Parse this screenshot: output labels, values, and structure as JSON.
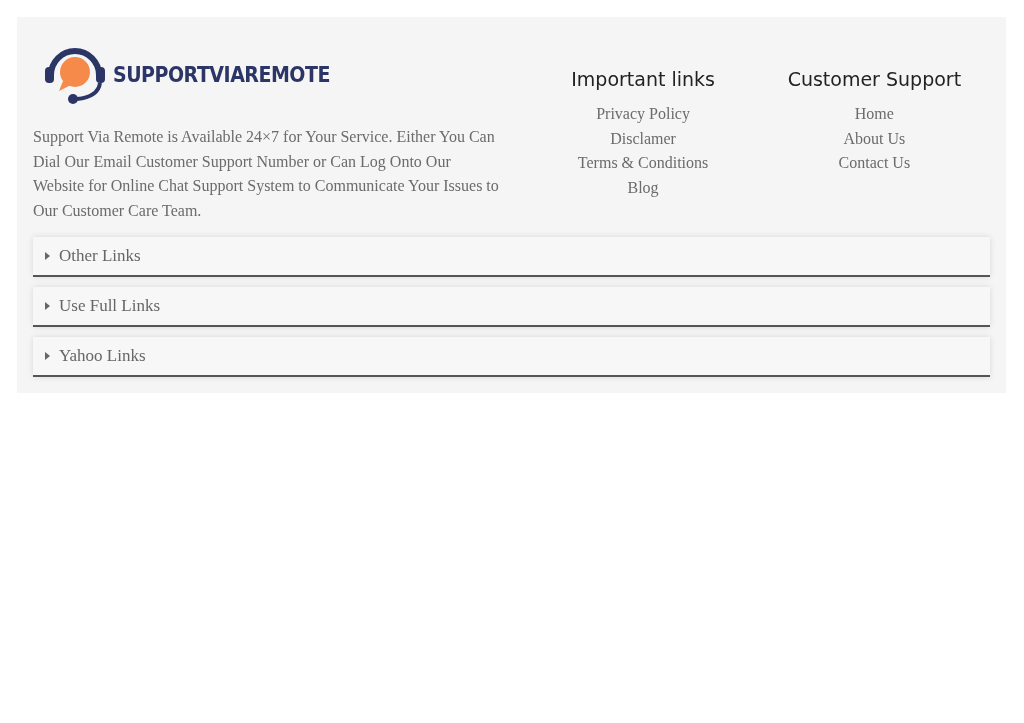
{
  "logo": {
    "text": "SUPPORTVIAREMOTE"
  },
  "about": "Support Via Remote is Available 24×7 for Your Service. Either You Can Dial Our Email Customer Support Number or Can Log Onto Our Website for Online Chat Support System to Communicate Your Issues to Our Customer Care Team.",
  "link_columns": [
    {
      "title": "Important links",
      "links": [
        "Privacy Policy",
        "Disclamer",
        "Terms & Conditions",
        "Blog"
      ]
    },
    {
      "title": "Customer Support",
      "links": [
        "Home",
        "About Us",
        "Contact Us"
      ]
    }
  ],
  "accordions": [
    {
      "label": "Other Links",
      "expanded": false
    },
    {
      "label": "Use Full Links",
      "expanded": false
    },
    {
      "label": "Yahoo Links",
      "expanded": false
    }
  ]
}
